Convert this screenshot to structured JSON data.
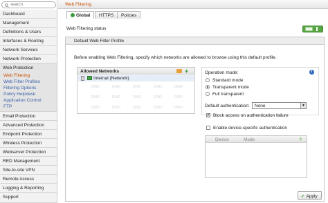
{
  "search": {
    "placeholder": "search"
  },
  "sidebar": {
    "items": [
      {
        "label": "Dashboard"
      },
      {
        "label": "Management"
      },
      {
        "label": "Definitions & Users"
      },
      {
        "label": "Interfaces & Routing"
      },
      {
        "label": "Network Services"
      },
      {
        "label": "Network Protection"
      },
      {
        "label": "Web Protection"
      },
      {
        "label": "Email Protection"
      },
      {
        "label": "Advanced Protection"
      },
      {
        "label": "Endpoint Protection"
      },
      {
        "label": "Wireless Protection"
      },
      {
        "label": "Webserver Protection"
      },
      {
        "label": "RED Management"
      },
      {
        "label": "Site-to-site VPN"
      },
      {
        "label": "Remote Access"
      },
      {
        "label": "Logging & Reporting"
      },
      {
        "label": "Support"
      }
    ],
    "subitems": [
      {
        "label": "Web Filtering"
      },
      {
        "label": "Web Filter Profiles"
      },
      {
        "label": "Filtering Options"
      },
      {
        "label": "Policy Helpdesk"
      },
      {
        "label": "Application Control"
      },
      {
        "label": "FTP"
      }
    ]
  },
  "header": {
    "title": "Web Filtering"
  },
  "tabs": [
    {
      "label": "Global"
    },
    {
      "label": "HTTPS"
    },
    {
      "label": "Policies"
    }
  ],
  "status": {
    "label": "Web Filtering status",
    "enabled": true
  },
  "profile": {
    "title": "Default Web Filter Profile",
    "description": "Before enabling Web Filtering, specify which networks are allowed to browse using this default profile.",
    "networks": {
      "header": "Allowed Networks",
      "rows": [
        {
          "name": "Internal (Network)"
        }
      ],
      "dnd_text": "DND"
    },
    "operation_mode": {
      "label": "Operation mode:",
      "options": [
        {
          "label": "Standard mode",
          "checked": false
        },
        {
          "label": "Transparent mode",
          "checked": true
        },
        {
          "label": "Full transparent",
          "checked": false
        }
      ]
    },
    "default_auth": {
      "label": "Default authentication:",
      "value": "None"
    },
    "block_access": {
      "label": "Block access on authentication failure",
      "checked": true
    },
    "device_specific": {
      "label": "Enable device-specific authentication",
      "checked": false
    },
    "devices_table": {
      "columns": [
        "Device",
        "Mode"
      ]
    }
  },
  "apply_button": {
    "label": "Apply"
  },
  "colors": {
    "accent": "#c85000",
    "link": "#3a5fa8",
    "toggle_on": "#58a543"
  }
}
